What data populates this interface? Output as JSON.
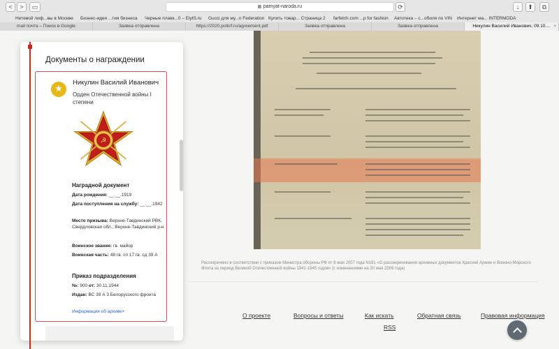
{
  "browser": {
    "url": "pamyat-naroda.ru",
    "nav": {
      "back": "<",
      "forward": ">",
      "sidebar": "▭",
      "reload": "⟳"
    },
    "toolbar": {
      "download": "↓",
      "share": "⬆",
      "tabs": "⧉"
    },
    "bookmarks": [
      "Нитевой лиф...вы в Москве",
      "Бизнес-идея ...тия бизнеса",
      "Черные плавк...0 – ElytS.ru",
      "Gucci для му...n Federation",
      "Купить товар... Страница 2",
      "farfetch.com ...p for fashion",
      "Автотека – с...обиля по VIN",
      "Интернет ма... INTERMODA"
    ],
    "tabs": [
      {
        "label": "mail почта – Поиск в Google",
        "active": false
      },
      {
        "label": "Заявка отправлена",
        "active": false
      },
      {
        "label": "https://2020.polkrf.ru/agreement.pdf",
        "active": false
      },
      {
        "label": "Заявка отправлена",
        "active": false
      },
      {
        "label": "Заявка отправлена",
        "active": false
      },
      {
        "label": "Никулин Василий Иванович, 09.10....",
        "active": true
      }
    ],
    "tab_close": "×"
  },
  "panel": {
    "title": "Документы о награждении",
    "card": {
      "person_name": "Никулин Василий Иванович",
      "award_name": "Орден Отечественной войны I степени",
      "section1_title": "Наградной документ",
      "birth_label": "Дата рождения:",
      "birth_value": "__.__.1919",
      "service_label": "Дата поступления на службу:",
      "service_value": "__.__.1942",
      "draft_label": "Место призыва:",
      "draft_value": "Верхне-Тавдинский РВК, Свердловская обл., Верхне-Тавдинский р-н",
      "rank_label": "Воинское звание:",
      "rank_value": "гв. майор",
      "unit_label": "Воинская часть:",
      "unit_value": "48 гв. сп 17 гв. сд 39 А",
      "section2_title": "Приказ подразделения",
      "order_no_label": "№:",
      "order_no_value": "900",
      "order_date_label": "от:",
      "order_date_value": "30.11.1944",
      "issuer_label": "Издан:",
      "issuer_value": "ВС 39 А 3 Белорусского фронта",
      "archive_link": "Информация об архиве+"
    }
  },
  "caption": "Рассекречено в соответствии с приказом Министра обороны РФ от 8 мая 2007 года N181 «О рассекречивании архивных документов Красной Армии и Военно-Морского Флота за период Великой Отечественной войны 1941-1945 годов» (с изменениями на 30 мая 2009 года)",
  "footer": {
    "links": [
      "О проекте",
      "Вопросы и ответы",
      "Как искать",
      "Обратная связь",
      "Правовая информация"
    ],
    "rss": "RSS"
  },
  "colors": {
    "accent_red": "#c62828",
    "card_border": "#e04b4b",
    "link_blue": "#2b63c8",
    "doc_highlight": "#e87850"
  }
}
